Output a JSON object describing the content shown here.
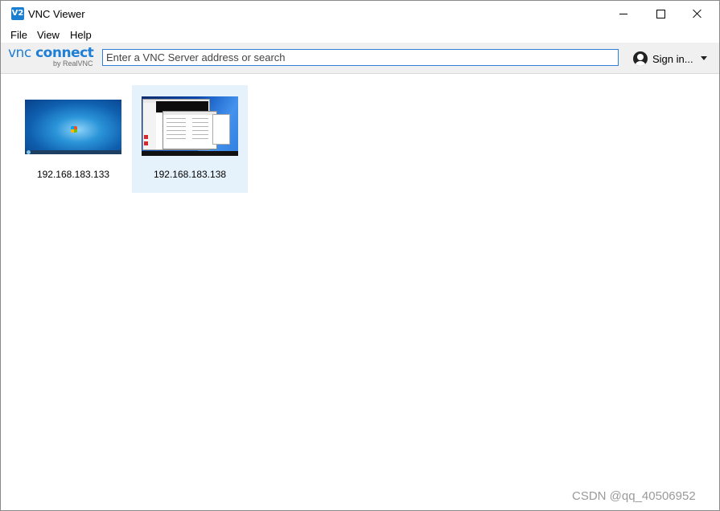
{
  "window": {
    "title": "VNC Viewer",
    "icon_name": "vnc-viewer-app-icon",
    "icon_text": "V2"
  },
  "menu": {
    "items": [
      "File",
      "View",
      "Help"
    ]
  },
  "toolbar": {
    "brand_vnc": "vnc",
    "brand_connect": "connect",
    "brand_sub": "by RealVNC",
    "search_placeholder": "Enter a VNC Server address or search",
    "search_value": "",
    "signin_label": "Sign in..."
  },
  "connections": [
    {
      "address": "192.168.183.133",
      "selected": false
    },
    {
      "address": "192.168.183.138",
      "selected": true
    }
  ],
  "watermark": "CSDN @qq_40506952",
  "colors": {
    "accent": "#1f7ed6",
    "selection": "#e5f1fb",
    "toolbar_bg": "#f0f0f0"
  }
}
